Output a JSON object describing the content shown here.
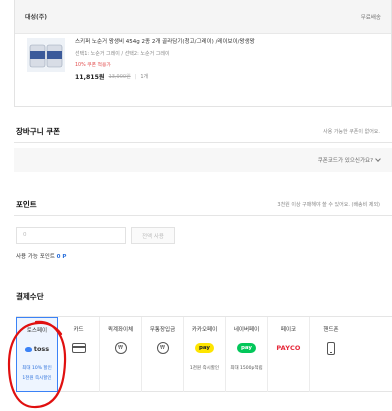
{
  "order": {
    "seller": "대성(주)",
    "shipping": "무료배송",
    "item_name": "스키퍼 노순거 왕생비 454g 2종 2개 골라담기(청고/그레이) /레이보이/왕생왕",
    "item_option": "선택1: 노순거 그레이 / 선택2: 노순거 그레이",
    "item_coupon": "10% 쿠폰 적용가",
    "price": "11,815원",
    "price_original": "13,900원",
    "quantity": "1개"
  },
  "cart_coupon": {
    "title": "장바구니 쿠폰",
    "note": "사용 가능한 쿠폰이 없어요.",
    "code_link": "쿠폰코드가 있으신가요?"
  },
  "points": {
    "title": "포인트",
    "note": "3천원 이상 구매해야 쓸 수 있어요. (배송비 제외)",
    "input_placeholder": "0",
    "use_all_label": "전액 사용",
    "available_label": "사용 가능 포인트",
    "available_value": "0 P"
  },
  "payment": {
    "title": "결제수단",
    "methods": [
      {
        "label": "토스페이",
        "logo": "toss",
        "sub1": "최대 10% 할인",
        "sub2": "1천원 즉시할인"
      },
      {
        "label": "카드",
        "icon": "card-icon"
      },
      {
        "label": "퀵계좌이체",
        "icon": "bank-transfer-icon"
      },
      {
        "label": "무통장입금",
        "icon": "deposit-icon"
      },
      {
        "label": "카카오페이",
        "logo": "pay",
        "sub1": "1천원 즉시할인"
      },
      {
        "label": "네이버페이",
        "logo": "pay",
        "sub1": "최대 1500p적립"
      },
      {
        "label": "페이코",
        "logo": "PAYCO"
      },
      {
        "label": "핸드폰",
        "icon": "phone-icon"
      }
    ]
  },
  "colors": {
    "accent": "#3b82f6",
    "annotation": "#e01010",
    "kakao": "#fee500",
    "naver": "#03c75a",
    "payco": "#e6283a"
  }
}
